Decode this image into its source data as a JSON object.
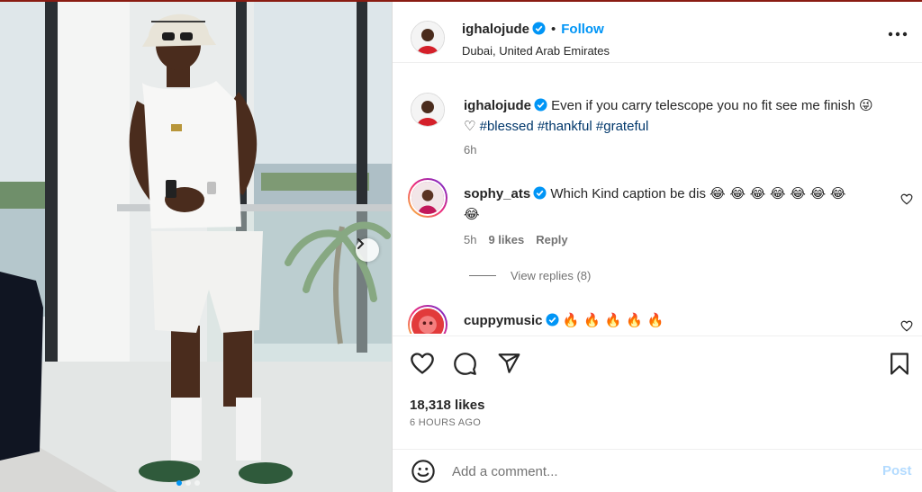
{
  "post": {
    "username": "ighalojude",
    "follow_label": "Follow",
    "bullet": "•",
    "location": "Dubai, United Arab Emirates",
    "caption": "Even if you carry telescope you no fit see me finish",
    "caption_emoji": "😜 ♡",
    "hashtags": [
      "#blessed",
      "#thankful",
      "#grateful"
    ],
    "caption_time": "6h",
    "likes": "18,318 likes",
    "posted": "6 HOURS AGO"
  },
  "comments": [
    {
      "username": "sophy_ats",
      "text": "Which Kind caption be dis",
      "emoji_line1": "😂 😂 😂 😂 😂 😂 😂",
      "emoji_line2": "😂",
      "time": "5h",
      "likes": "9 likes",
      "reply_label": "Reply",
      "view_replies": "View replies (8)"
    },
    {
      "username": "cuppymusic",
      "emoji": "🔥 🔥 🔥 🔥 🔥"
    }
  ],
  "composer": {
    "placeholder": "Add a comment...",
    "post_label": "Post"
  },
  "icons": {
    "verified": "verified-badge-icon",
    "more": "more-options-icon",
    "like": "heart-icon",
    "comment": "comment-icon",
    "share": "send-icon",
    "save": "bookmark-icon",
    "emoji": "emoji-smile-icon",
    "next": "chevron-right-icon"
  },
  "colors": {
    "accent": "#0095f6",
    "hashtag": "#00376b",
    "muted": "#737373",
    "post_disabled": "#b3dbff"
  }
}
